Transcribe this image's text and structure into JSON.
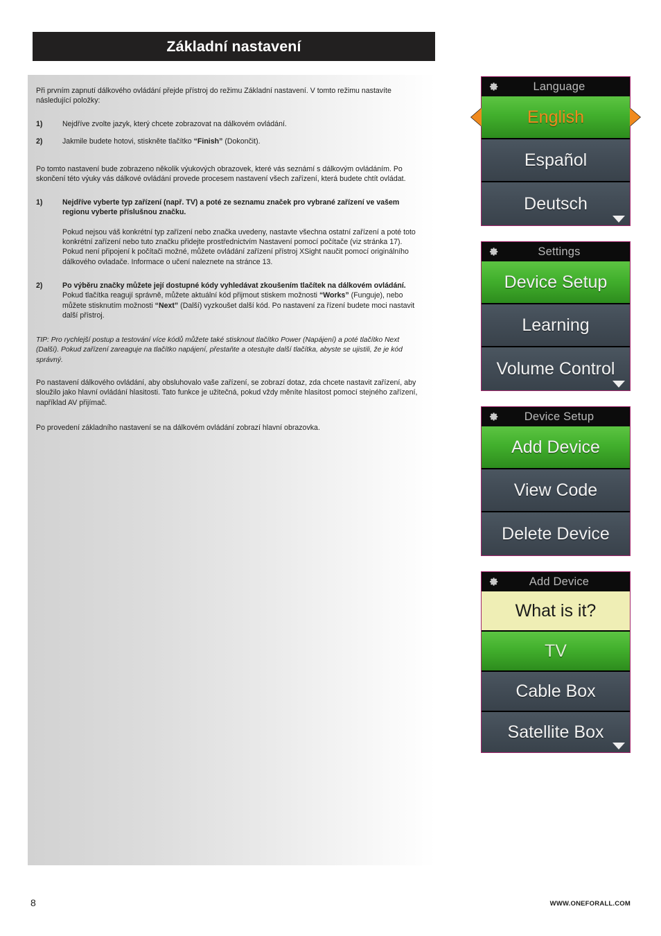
{
  "page": {
    "title": "Základní nastavení",
    "number": "8",
    "website": "WWW.ONEFORALL.COM"
  },
  "content": {
    "intro": "Při prvním zapnutí dálkového ovládání přejde přístroj do režimu Základní nastavení. V tomto režimu nastavíte následující položky:",
    "list1": [
      {
        "num": "1)",
        "text": "Nejdříve zvolte jazyk, který chcete zobrazovat na dálkovém ovládání."
      },
      {
        "num": "2)",
        "text_before": "Jakmile budete hotovi, stiskněte tlačítko ",
        "bold": "“Finish”",
        "text_after": " (Dokončit)."
      }
    ],
    "para2": "Po tomto nastavení bude zobrazeno několik výukových obrazovek, které vás seznámí s dálkovým ovládáním. Po skončení této výuky vás dálkové ovládání provede procesem nastavení všech zařízení, která budete chtít ovládat.",
    "item1": {
      "num": "1)",
      "bold": "Nejdříve vyberte typ zařízení (např. TV) a poté ze seznamu značek pro vybrané zařízení ve vašem regionu vyberte příslušnou značku.",
      "detail": "Pokud nejsou váš konkrétní typ zařízení nebo značka uvedeny, nastavte všechna ostatní zařízení a poté toto konkrétní zařízení nebo tuto značku přidejte prostřednictvím Nastavení pomocí počítače (viz stránka 17). Pokud není připojení k počítači možné, můžete ovládání zařízení přístroj XSight naučit pomocí originálního dálkového ovladače. Informace o učení naleznete na stránce 13."
    },
    "item2": {
      "num": "2)",
      "bold": "Po výběru značky můžete její dostupné kódy vyhledávat zkoušením tlačítek na dálkovém ovládání.",
      "mid1": " Pokud tlačítka reagují správně, můžete aktuální kód přijmout stiskem možnosti ",
      "bold2": "“Works”",
      "mid2": " (Funguje), nebo můžete stisknutím možnosti ",
      "bold3": "“Next”",
      "mid3": " (Další) vyzkoušet další kód. Po nastavení za řízení budete moci nastavit další přístroj."
    },
    "tip": "TIP: Pro rychlejší postup a testování více kódů můžete také stisknout tlačítko Power (Napájení) a poté tlačítko Next (Další). Pokud zařízení zareaguje na tlačítko napájení, přestaňte a otestujte další tlačítka, abyste se ujistili, že je kód správný.",
    "para3": "Po nastavení dálkového ovládání, aby obsluhovalo vaše zařízení, se zobrazí dotaz, zda chcete nastavit zařízení, aby sloužilo jako hlavní ovládání hlasitosti.  Tato funkce je užitečná, pokud vždy měníte hlasitost pomocí stejného zařízení, například AV přijímač.",
    "para4": "Po provedení základního nastavení se na dálkovém ovládání zobrazí hlavní obrazovka."
  },
  "screens": [
    {
      "header": "Language",
      "icon": "gear-icon",
      "has_scroll_down": true,
      "rows": [
        {
          "label": "English",
          "state": "selected-green-orange",
          "arrows": true
        },
        {
          "label": "Español",
          "state": "gray"
        },
        {
          "label": "Deutsch",
          "state": "gray"
        }
      ]
    },
    {
      "header": "Settings",
      "icon": "gear-icon",
      "has_scroll_down": true,
      "rows": [
        {
          "label": "Device Setup",
          "state": "green"
        },
        {
          "label": "Learning",
          "state": "gray"
        },
        {
          "label": "Volume Control",
          "state": "gray"
        }
      ]
    },
    {
      "header": "Device Setup",
      "icon": "gear-icon",
      "has_scroll_down": false,
      "rows": [
        {
          "label": "Add Device",
          "state": "green"
        },
        {
          "label": "View Code",
          "state": "gray"
        },
        {
          "label": "Delete Device",
          "state": "gray"
        }
      ]
    },
    {
      "header": "Add Device",
      "icon": "gear-icon",
      "has_scroll_down": true,
      "rows": [
        {
          "label": "What is it?",
          "state": "yellow"
        },
        {
          "label": "TV",
          "state": "green-dim"
        },
        {
          "label": "Cable Box",
          "state": "gray"
        },
        {
          "label": "Satellite Box",
          "state": "gray"
        }
      ]
    }
  ],
  "colors": {
    "accent_green": "#42b02d",
    "highlight_orange": "#f08a1e",
    "header_black": "#0c0c0c",
    "row_gray": "#434d57",
    "yellow": "#efeeb5",
    "screen_border": "#a3246b"
  }
}
